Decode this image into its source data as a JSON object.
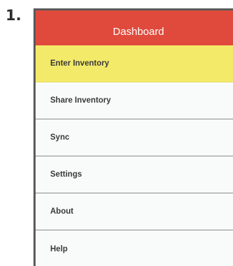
{
  "step": {
    "label": "1."
  },
  "header": {
    "title": "Dashboard"
  },
  "colors": {
    "header": "#e04a3c",
    "active_item": "#f3ea69",
    "item_background": "#f9fbfb",
    "divider": "#8a8a8a"
  },
  "menu": {
    "items": [
      {
        "label": "Enter Inventory",
        "active": true
      },
      {
        "label": "Share Inventory",
        "active": false
      },
      {
        "label": "Sync",
        "active": false
      },
      {
        "label": "Settings",
        "active": false
      },
      {
        "label": "About",
        "active": false
      },
      {
        "label": "Help",
        "active": false
      }
    ]
  }
}
